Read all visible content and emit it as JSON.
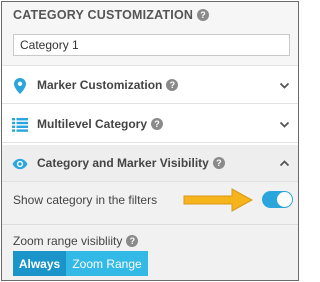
{
  "header": {
    "title": "CATEGORY CUSTOMIZATION",
    "help_icon": "?"
  },
  "category_name": {
    "value": "Category 1"
  },
  "sections": [
    {
      "label": "Marker Customization",
      "icon": "map-pin-icon",
      "state": "collapsed",
      "help_icon": "?"
    },
    {
      "label": "Multilevel Category",
      "icon": "list-icon",
      "state": "collapsed",
      "help_icon": "?"
    },
    {
      "label": "Category and Marker Visibility",
      "icon": "eye-icon",
      "state": "expanded",
      "help_icon": "?"
    }
  ],
  "visibility": {
    "show_in_filters_label": "Show category in the filters",
    "show_in_filters_on": true,
    "zoom_label": "Zoom range visibliity",
    "zoom_help_icon": "?",
    "zoom_options": [
      "Always",
      "Zoom Range"
    ],
    "zoom_selected": "Always"
  },
  "colors": {
    "accent": "#2aa6dc",
    "segment_active": "#1b95c9",
    "segment_inactive": "#33b9e6",
    "arrow": "#f5b31c",
    "header_bg": "#f6f6f6"
  }
}
